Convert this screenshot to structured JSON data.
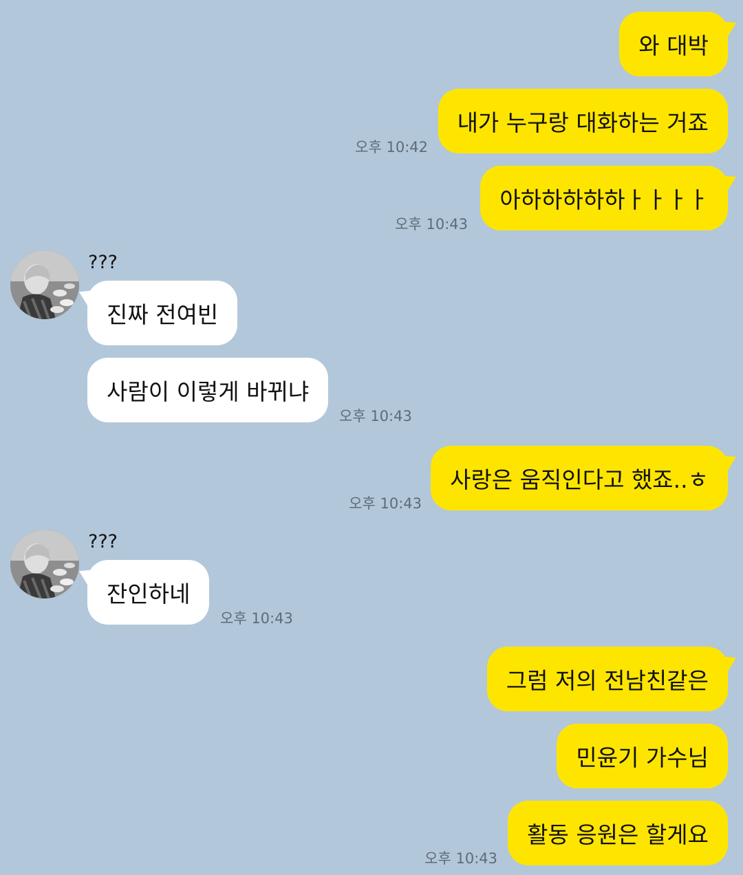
{
  "chat": {
    "messages": [
      {
        "text": "와 대박"
      },
      {
        "text": "내가 누구랑 대화하는 거죠"
      },
      {
        "text": "아하하하하하ㅏㅏㅏㅏ"
      },
      {
        "text": "진짜 전여빈"
      },
      {
        "text": "사람이 이렇게 바뀌냐"
      },
      {
        "text": "사랑은 움직인다고 했죠..ㅎ"
      },
      {
        "text": "잔인하네"
      },
      {
        "text": "그럼 저의 전남친같은"
      },
      {
        "text": "민윤기 가수님"
      },
      {
        "text": "활동 응원은 할게요"
      }
    ],
    "times": {
      "t1": "오후 10:42",
      "t2": "오후 10:43",
      "t3": "오후 10:43",
      "t4": "오후 10:43",
      "t5": "오후 10:43",
      "t6": "오후 10:43"
    },
    "sender_name": "???"
  },
  "colors": {
    "background": "#b2c7da",
    "sent_bubble": "#fee500",
    "received_bubble": "#ffffff"
  }
}
